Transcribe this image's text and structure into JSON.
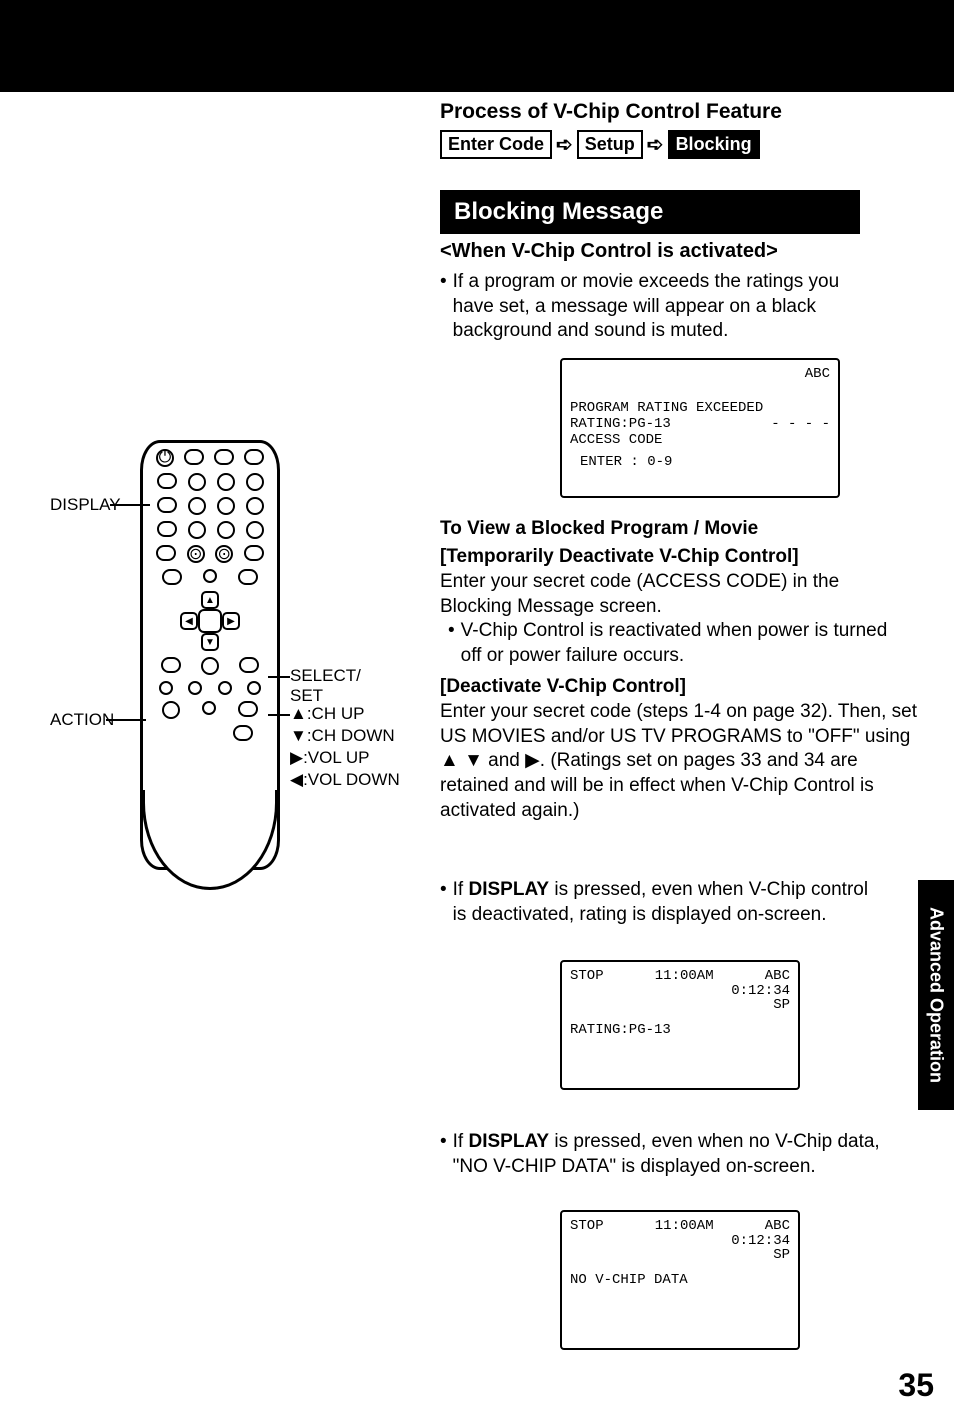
{
  "process": {
    "title": "Process of V-Chip Control Feature",
    "step1": "Enter Code",
    "step2": "Setup",
    "step3": "Blocking"
  },
  "section_header": "Blocking Message",
  "when_activated": "<When V-Chip Control is activated>",
  "para_activated": "If a program or movie exceeds the ratings you have set, a message will appear on a black background and sound is muted.",
  "screen1": {
    "channel": "ABC",
    "line1": "PROGRAM RATING EXCEEDED",
    "rating": "RATING:PG-13",
    "access": "ACCESS CODE",
    "dashes": "- - - -",
    "enter": "ENTER : 0-9"
  },
  "view_title": "To View a Blocked Program / Movie",
  "temp": {
    "title": "[Temporarily Deactivate V-Chip Control]",
    "p1": "Enter your secret code (ACCESS CODE) in the Blocking Message screen.",
    "p2": "V-Chip Control is reactivated when power is turned off or power failure occurs."
  },
  "deact": {
    "title": "[Deactivate V-Chip Control]",
    "p1": "Enter your secret code (steps 1-4 on page 32). Then, set US MOVIES and/or US TV PROGRAMS to \"OFF\" using ▲ ▼ and ▶. (Ratings set on pages 33 and 34 are retained and will be in effect when V-Chip Control is activated again.)"
  },
  "disp1_pre": "If ",
  "disp1_bold": "DISPLAY",
  "disp1_post": " is pressed, even when V-Chip control is deactivated, rating is displayed on-screen.",
  "screen2": {
    "stop": "STOP",
    "time": "11:00AM",
    "channel": "ABC",
    "counter": "0:12:34",
    "sp": "SP",
    "rating": "RATING:PG-13"
  },
  "disp2_pre": "If ",
  "disp2_bold": "DISPLAY",
  "disp2_post": " is pressed, even when no V-Chip data, \"NO V-CHIP DATA\" is displayed on-screen.",
  "screen3": {
    "stop": "STOP",
    "time": "11:00AM",
    "channel": "ABC",
    "counter": "0:12:34",
    "sp": "SP",
    "novchip": "NO V-CHIP DATA"
  },
  "remote": {
    "display": "DISPLAY",
    "action": "ACTION",
    "select": "SELECT/\nSET",
    "chup": "▲:CH UP",
    "chdown": "▼:CH DOWN",
    "volup": "▶:VOL UP",
    "voldown": "◀:VOL DOWN"
  },
  "side_tab": "Advanced Operation",
  "page_number": "35"
}
